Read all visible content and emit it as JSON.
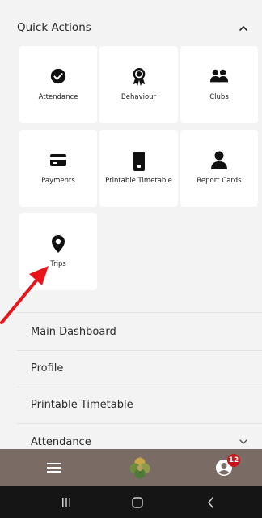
{
  "quick_actions": {
    "title": "Quick Actions",
    "tiles": [
      {
        "label": "Attendance",
        "icon": "check-circle-icon"
      },
      {
        "label": "Behaviour",
        "icon": "award-icon"
      },
      {
        "label": "Clubs",
        "icon": "users-icon"
      },
      {
        "label": "Payments",
        "icon": "credit-card-icon"
      },
      {
        "label": "Printable Timetable",
        "icon": "mobile-icon"
      },
      {
        "label": "Report Cards",
        "icon": "person-icon"
      },
      {
        "label": "Trips",
        "icon": "map-pin-icon"
      }
    ]
  },
  "menu": {
    "items": [
      {
        "label": "Main Dashboard"
      },
      {
        "label": "Profile"
      },
      {
        "label": "Printable Timetable"
      },
      {
        "label": "Attendance"
      }
    ]
  },
  "app_bar": {
    "badge_count": "12",
    "icons": [
      "hamburger-menu-icon",
      "app-logo-icon",
      "account-icon"
    ]
  },
  "system_nav": {
    "icons": [
      "recents-icon",
      "home-icon",
      "back-icon"
    ]
  },
  "colors": {
    "background": "#f3f3f3",
    "tile": "#ffffff",
    "app_bar": "#7a6b64",
    "system_bar": "#151515",
    "badge": "#c8141b",
    "annotation_arrow": "#e8141b"
  }
}
